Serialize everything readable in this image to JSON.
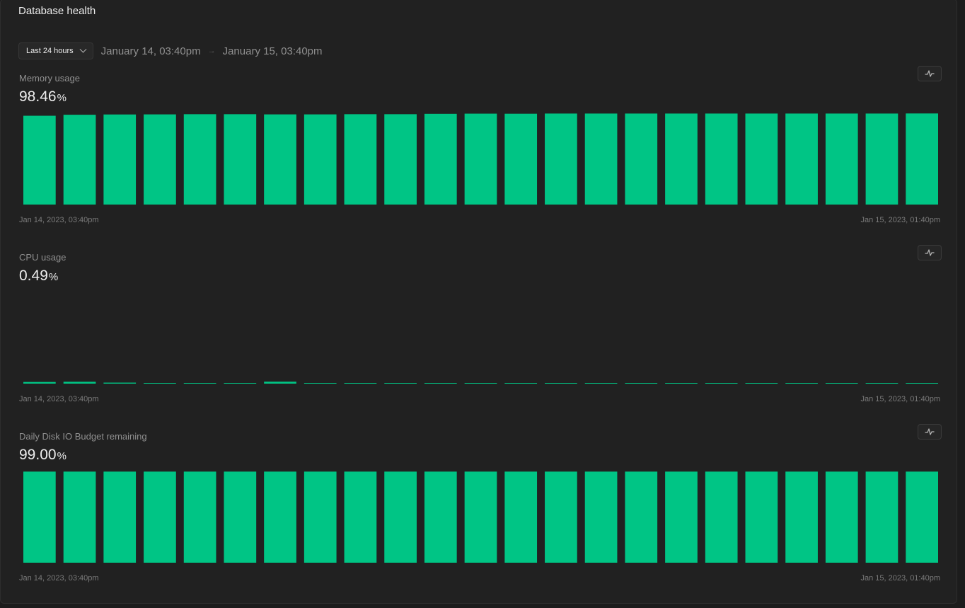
{
  "header": {
    "title": "Database health"
  },
  "range": {
    "selected": "Last 24 hours",
    "start": "January 14, 03:40pm",
    "end": "January 15, 03:40pm"
  },
  "metrics": [
    {
      "label": "Memory usage",
      "value": "98.46",
      "unit": "%",
      "x_start": "Jan 14, 2023, 03:40pm",
      "x_end": "Jan 15, 2023, 01:40pm"
    },
    {
      "label": "CPU usage",
      "value": "0.49",
      "unit": "%",
      "x_start": "Jan 14, 2023, 03:40pm",
      "x_end": "Jan 15, 2023, 01:40pm"
    },
    {
      "label": "Daily Disk IO Budget remaining",
      "value": "99.00",
      "unit": "%",
      "x_start": "Jan 14, 2023, 03:40pm",
      "x_end": "Jan 15, 2023, 01:40pm"
    }
  ],
  "colors": {
    "bar": "#00c585",
    "accent": "#00c585"
  },
  "chart_data": [
    {
      "type": "bar",
      "title": "Memory usage",
      "ylim": [
        0,
        100
      ],
      "values": [
        96.5,
        97.6,
        97.9,
        98.0,
        98.2,
        98.2,
        98.0,
        98.0,
        98.2,
        98.2,
        98.6,
        98.8,
        98.7,
        98.9,
        98.9,
        98.9,
        98.9,
        98.9,
        98.9,
        98.9,
        98.9,
        98.9,
        99.0
      ],
      "x_start": "Jan 14, 2023, 03:40pm",
      "x_end": "Jan 15, 2023, 01:40pm"
    },
    {
      "type": "bar",
      "title": "CPU usage",
      "ylim": [
        0,
        100
      ],
      "values": [
        1.8,
        2.0,
        1.1,
        0.6,
        0.7,
        0.4,
        2.1,
        0.4,
        0.6,
        0.4,
        0.6,
        0.4,
        0.6,
        0.4,
        0.6,
        0.6,
        0.5,
        0.4,
        0.5,
        0.4,
        0.4,
        0.4,
        0.5
      ],
      "x_start": "Jan 14, 2023, 03:40pm",
      "x_end": "Jan 15, 2023, 01:40pm"
    },
    {
      "type": "bar",
      "title": "Daily Disk IO Budget remaining",
      "ylim": [
        0,
        100
      ],
      "values": [
        99,
        99,
        99,
        99,
        99,
        99,
        99,
        99,
        99,
        99,
        99,
        99,
        99,
        99,
        99,
        99,
        99,
        99,
        99,
        99,
        99,
        99,
        99
      ],
      "x_start": "Jan 14, 2023, 03:40pm",
      "x_end": "Jan 15, 2023, 01:40pm"
    }
  ]
}
